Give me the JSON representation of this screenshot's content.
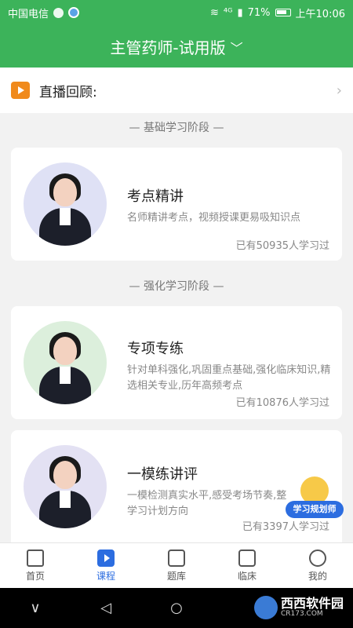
{
  "status": {
    "carrier": "中国电信",
    "signal": "⁴ᴳ",
    "battery": "71%",
    "time": "上午10:06"
  },
  "header": {
    "title": "主管药师-试用版",
    "chevron": "﹀"
  },
  "live": {
    "label": "直播回顾:",
    "arrow": "›"
  },
  "stages": [
    "— 基础学习阶段 —",
    "— 强化学习阶段 —"
  ],
  "courses": [
    {
      "title": "考点精讲",
      "desc": "名师精讲考点，视频授课更易吸知识点",
      "count": "已有50935人学习过"
    },
    {
      "title": "专项专练",
      "desc": "针对单科强化,巩固重点基础,强化临床知识,精选相关专业,历年高频考点",
      "count": "已有10876人学习过"
    },
    {
      "title": "一模练讲评",
      "desc": "一模检测真实水平,感受考场节奏,整学习计划方向",
      "count": "已有3397人学习过"
    }
  ],
  "badge": {
    "label": "学习规划师"
  },
  "nav": [
    {
      "label": "首页"
    },
    {
      "label": "课程"
    },
    {
      "label": "题库"
    },
    {
      "label": "临床"
    },
    {
      "label": "我的"
    }
  ],
  "watermark": {
    "name": "西西软件园",
    "url": "CR173.COM"
  },
  "colors": {
    "brand_green": "#3cb35a",
    "accent_blue": "#2c6de0",
    "tv_orange": "#f08a1c"
  }
}
